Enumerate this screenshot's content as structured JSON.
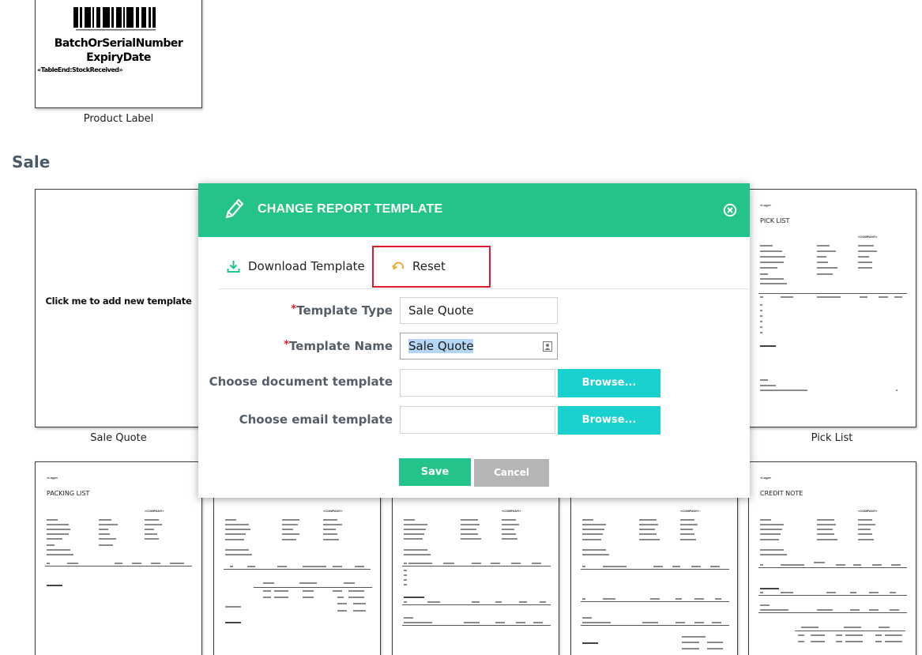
{
  "label_section": {
    "card": {
      "caption": "Product Label",
      "lines": [
        "BatchOrSerialNumber",
        "ExpiryDate",
        "«TableEnd:StockReceived»"
      ]
    }
  },
  "sale_section": {
    "title": "Sale",
    "cards": [
      {
        "caption": "Sale Quote",
        "add_text": "Click me to add new template"
      },
      {
        "caption": "Pick List",
        "doc_title": "PICK LIST"
      }
    ],
    "bottom_cards": [
      {
        "doc_title": "PACKING LIST"
      },
      {
        "doc_title": ""
      },
      {
        "doc_title": ""
      },
      {
        "doc_title": ""
      },
      {
        "doc_title": "CREDIT NOTE"
      }
    ],
    "doc_tags": {
      "logo": "«Logo»",
      "company": "«COMPANY»"
    }
  },
  "modal": {
    "title": "CHANGE REPORT TEMPLATE",
    "download_label": "Download Template",
    "reset_label": "Reset",
    "fields": {
      "template_type_label": "Template Type",
      "template_type_value": "Sale Quote",
      "template_name_label": "Template Name",
      "template_name_value": "Sale Quote",
      "doc_template_label": "Choose document template",
      "email_template_label": "Choose email template",
      "browse_label": "Browse..."
    },
    "save_label": "Save",
    "cancel_label": "Cancel",
    "colors": {
      "header": "#24c389",
      "browse": "#19d1cf",
      "highlight": "#e0192b"
    }
  }
}
